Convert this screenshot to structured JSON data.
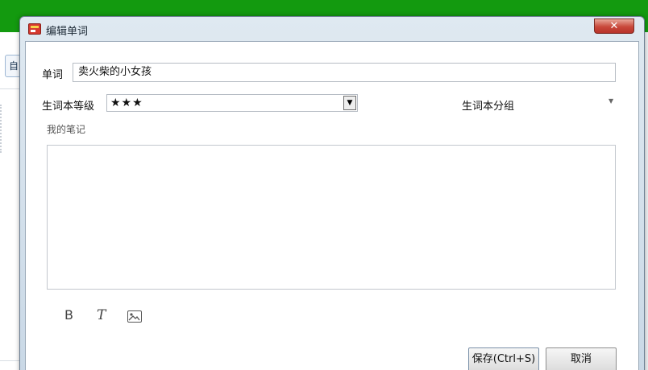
{
  "background_app": {
    "tab_fragment": "自"
  },
  "dialog": {
    "title": "编辑单词",
    "close_symbol": "✕"
  },
  "form": {
    "word_label": "单词",
    "word_value": "卖火柴的小女孩",
    "level_label": "生词本等级",
    "level_value": "★★★",
    "level_dropdown_symbol": "▼",
    "group_label": "生词本分组",
    "group_dropdown_symbol": "▼",
    "notes_label": "我的笔记",
    "notes_value": ""
  },
  "toolbar": {
    "bold_label": "B",
    "italic_label": "T",
    "image_icon": "image-icon"
  },
  "buttons": {
    "save_label": "保存(Ctrl+S)",
    "cancel_label": "取消"
  },
  "colors": {
    "app_header_green": "#139a0f",
    "close_button_red": "#c8483a"
  }
}
